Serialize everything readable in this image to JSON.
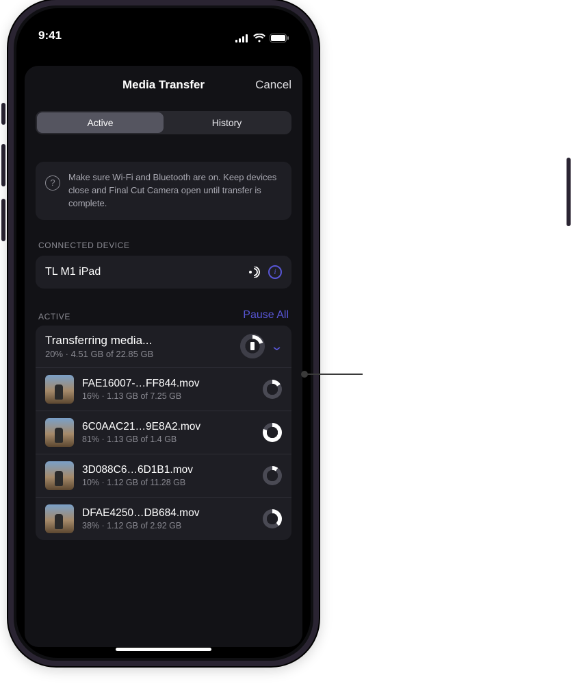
{
  "status": {
    "time": "9:41"
  },
  "sheet": {
    "title": "Media Transfer",
    "cancel": "Cancel",
    "tabs": {
      "active": "Active",
      "history": "History"
    },
    "tip": "Make sure Wi-Fi and Bluetooth are on. Keep devices close and Final Cut Camera open until transfer is complete.",
    "connectedLabel": "CONNECTED DEVICE",
    "deviceName": "TL M1 iPad",
    "activeLabel": "ACTIVE",
    "pauseAll": "Pause All",
    "summary": {
      "title": "Transferring media...",
      "meta": "20% · 4.51 GB of 22.85 GB"
    },
    "files": [
      {
        "name": "FAE16007-…FF844.mov",
        "meta": "16% · 1.13 GB of 7.25 GB",
        "progressDeg": 58
      },
      {
        "name": "6C0AAC21…9E8A2.mov",
        "meta": "81% · 1.13 GB of 1.4 GB",
        "progressDeg": 292
      },
      {
        "name": "3D088C6…6D1B1.mov",
        "meta": "10% · 1.12 GB of 11.28 GB",
        "progressDeg": 36
      },
      {
        "name": "DFAE4250…DB684.mov",
        "meta": "38% · 1.12 GB of 2.92 GB",
        "progressDeg": 137
      }
    ]
  }
}
